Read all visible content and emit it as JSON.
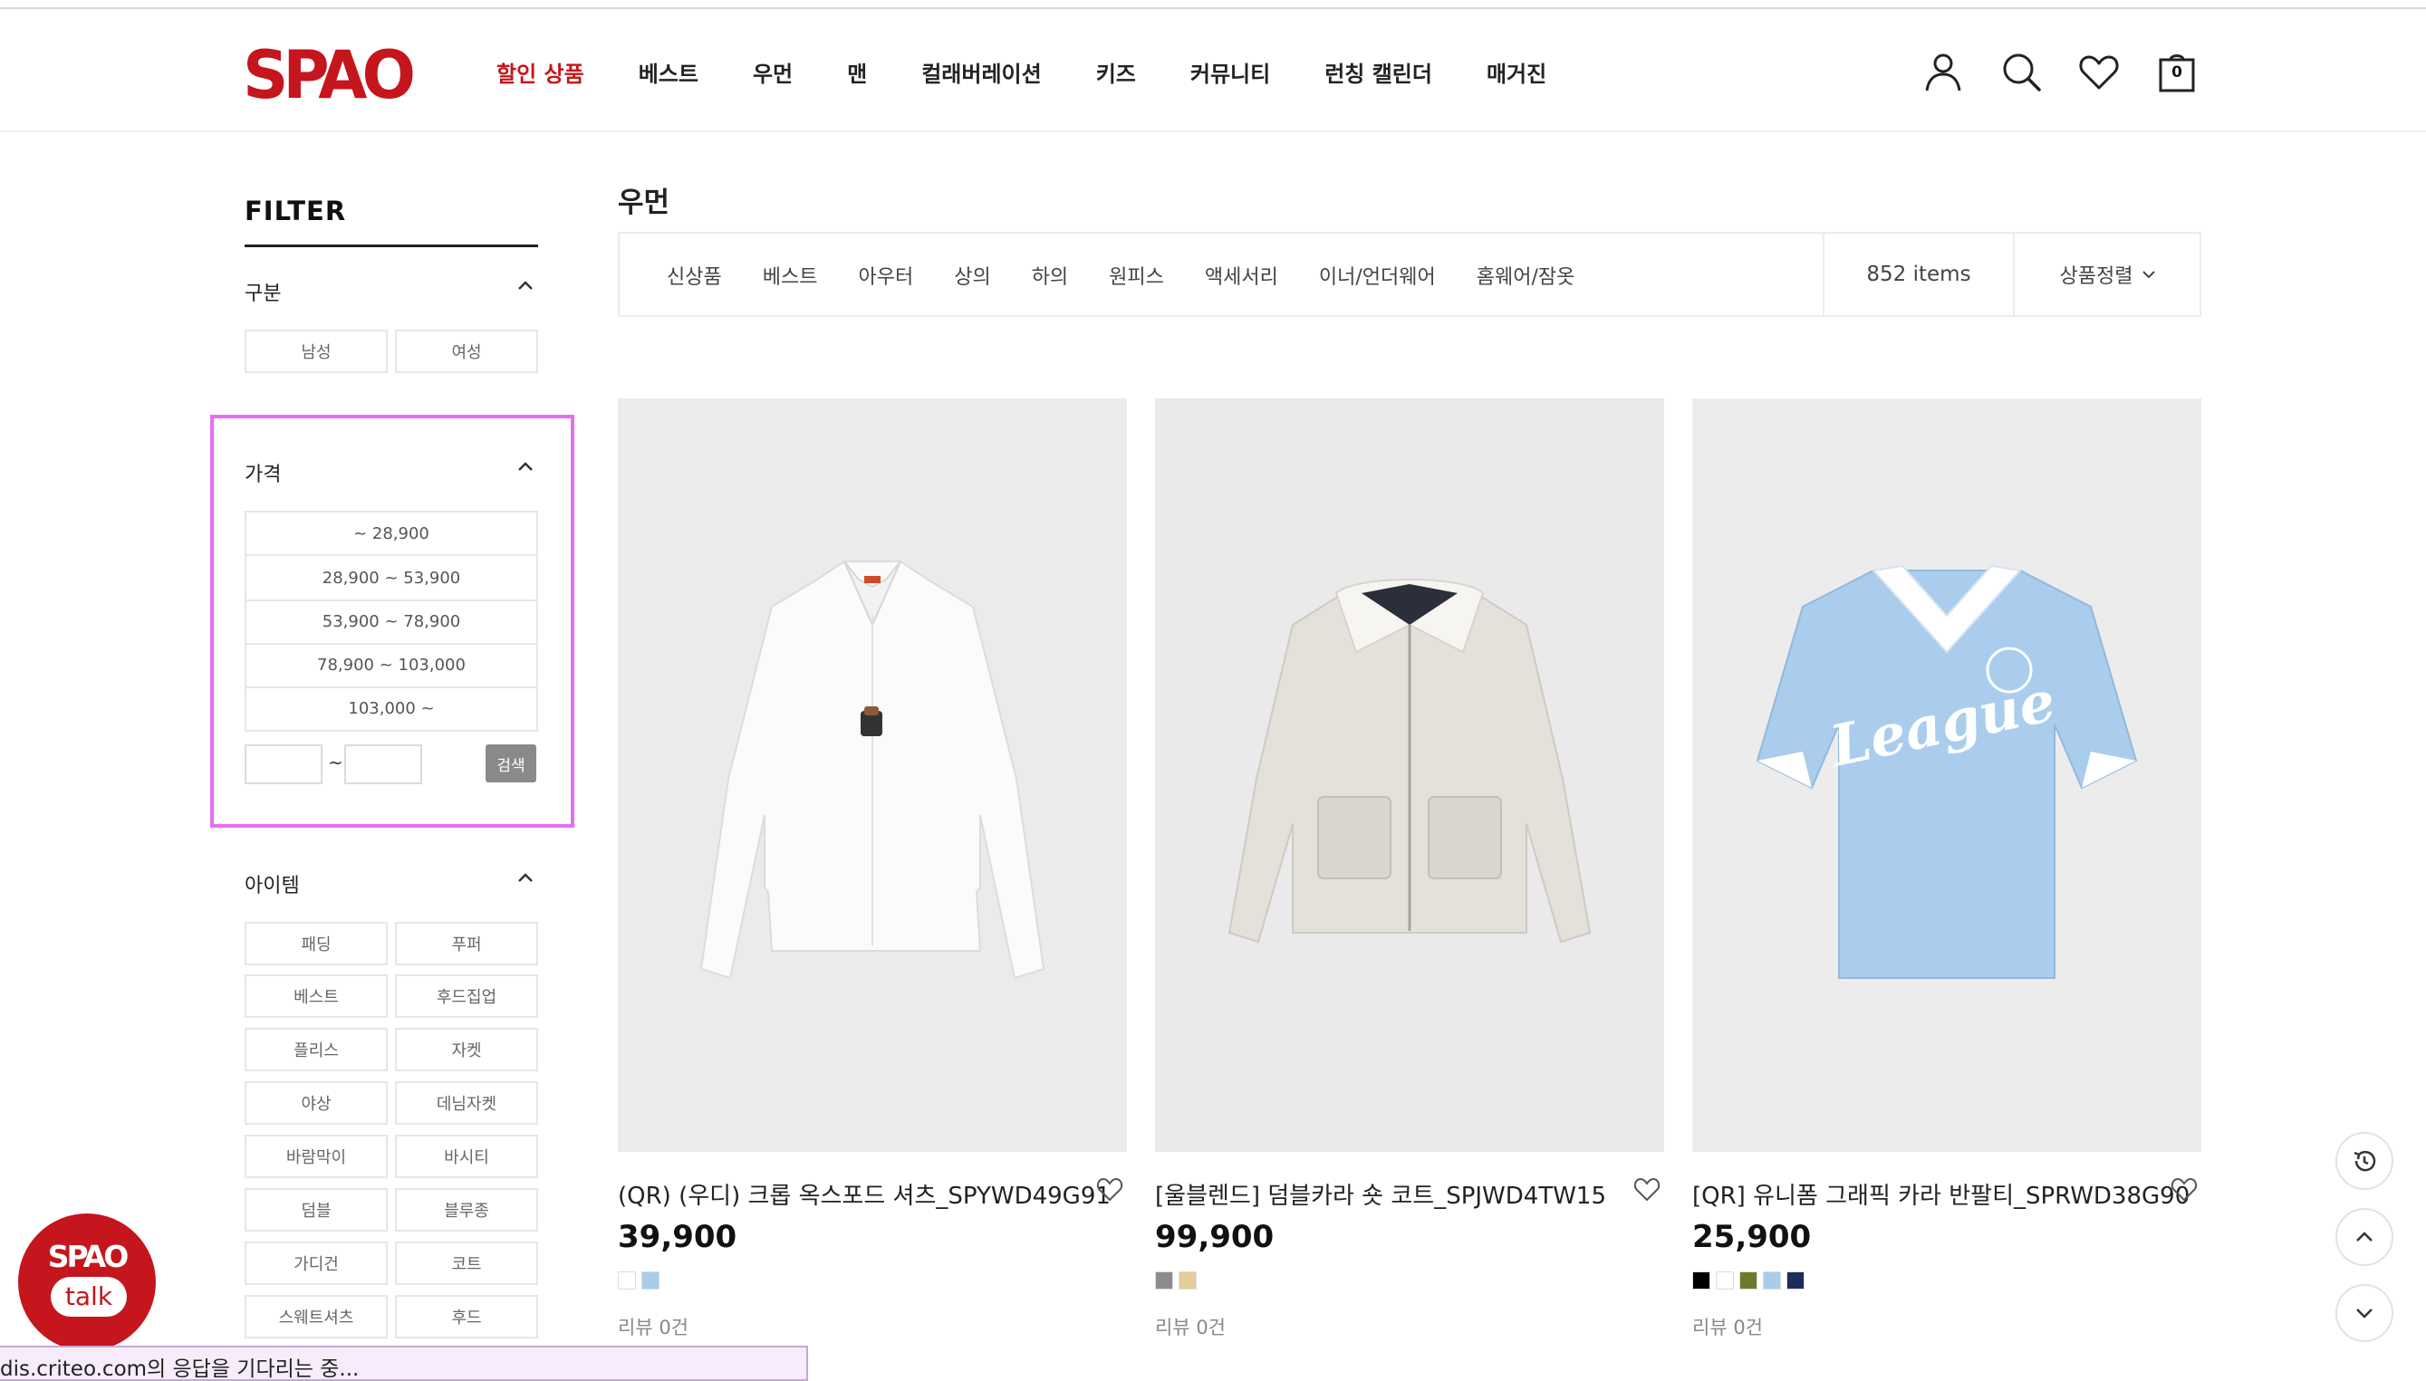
{
  "brand": {
    "logo_text": "SPAO",
    "accent": "#c4161c"
  },
  "nav": {
    "items": [
      "할인 상품",
      "베스트",
      "우먼",
      "맨",
      "컬래버레이션",
      "키즈",
      "커뮤니티",
      "런칭 캘린더",
      "매거진"
    ]
  },
  "header_icons": {
    "user": "user-icon",
    "search": "search-icon",
    "wishlist": "heart-icon",
    "cart": "shopping-bag-icon",
    "cart_count": "0"
  },
  "filter": {
    "title": "FILTER",
    "gender": {
      "title": "구분",
      "options": [
        "남성",
        "여성"
      ]
    },
    "price": {
      "title": "가격",
      "ranges": [
        "~ 28,900",
        "28,900 ~ 53,900",
        "53,900 ~ 78,900",
        "78,900 ~ 103,000",
        "103,000 ~"
      ],
      "min_value": "",
      "max_value": "",
      "separator": "~",
      "search_label": "검색"
    },
    "item": {
      "title": "아이템",
      "options": [
        "패딩",
        "푸퍼",
        "베스트",
        "후드집업",
        "플리스",
        "자켓",
        "야상",
        "데님자켓",
        "바람막이",
        "바시티",
        "덤블",
        "블루종",
        "가디건",
        "코트",
        "스웨트셔츠",
        "후드"
      ]
    }
  },
  "main": {
    "title": "우먼",
    "categories": [
      "신상품",
      "베스트",
      "아우터",
      "상의",
      "하의",
      "원피스",
      "액세서리",
      "이너/언더웨어",
      "홈웨어/잠옷"
    ],
    "item_count": "852 items",
    "sort_label": "상품정렬"
  },
  "products": [
    {
      "name": "(QR) (우디) 크롭 옥스포드 셔츠_SPYWD49G91",
      "price": "39,900",
      "swatches": [
        "#ffffff",
        "#a9cde8"
      ],
      "review": "리뷰 0건"
    },
    {
      "name": "[울블렌드] 덤블카라 숏 코트_SPJWD4TW15",
      "price": "99,900",
      "swatches": [
        "#8c8c8c",
        "#e6cc98"
      ],
      "review": "리뷰 0건"
    },
    {
      "name": "[QR] 유니폼 그래픽 카라 반팔티_SPRWD38G90",
      "price": "25,900",
      "swatches": [
        "#000000",
        "#ffffff",
        "#6b7a2a",
        "#a9cde8",
        "#1d2a5c"
      ],
      "review": "리뷰 0건"
    }
  ],
  "floating": {
    "recent": "history-icon",
    "top": "arrow-up-icon",
    "down": "arrow-down-icon"
  },
  "talk": {
    "logo": "SPAO",
    "label": "talk"
  },
  "status": {
    "text": "dis.criteo.com의 응답을 기다리는 중..."
  }
}
